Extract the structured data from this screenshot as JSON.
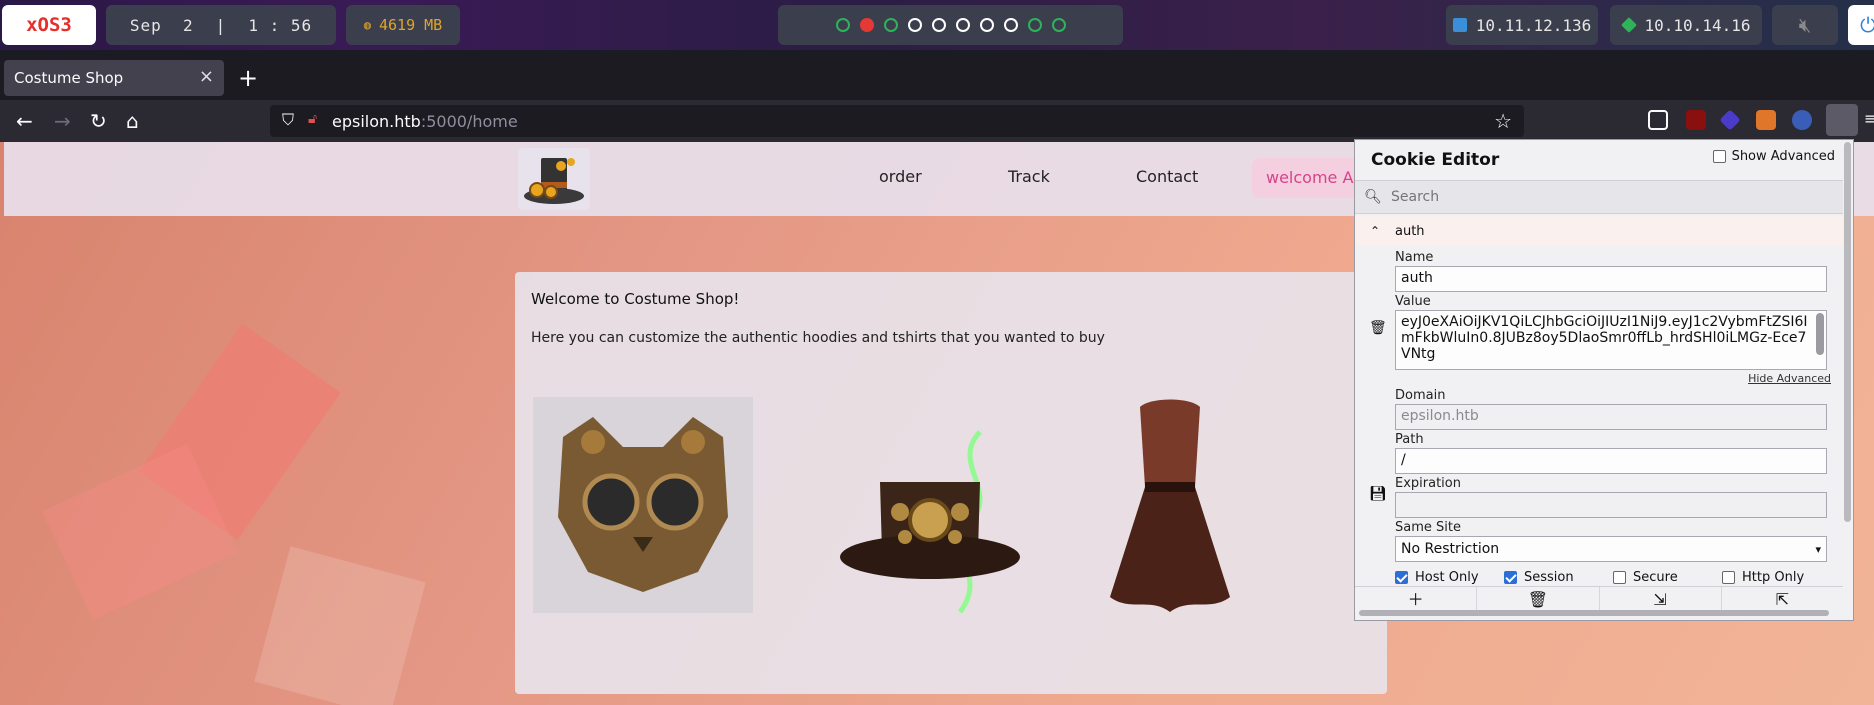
{
  "system_bar": {
    "os_label": "xOS3",
    "date": "Sep  2",
    "time": "1 : 56",
    "memory": "4619 MB",
    "ip_tun": "10.11.12.136",
    "ip_vpn": "10.10.14.16",
    "workspaces": [
      "green",
      "red",
      "green",
      "white",
      "white",
      "white",
      "white",
      "white",
      "green",
      "green"
    ]
  },
  "browser": {
    "tab_title": "Costume Shop",
    "url_host": "epsilon.htb",
    "url_path": ":5000/home"
  },
  "site": {
    "nav": {
      "order": "order",
      "track": "Track",
      "contact": "Contact",
      "welcome": "welcome Admin"
    },
    "welcome_heading": "Welcome to Costume Shop!",
    "welcome_text": "Here you can customize the authentic hoodies and tshirts that you wanted to buy",
    "products": [
      "cat-mask",
      "steampunk-hat",
      "corset-dress"
    ]
  },
  "cookie_editor": {
    "title": "Cookie Editor",
    "show_advanced": "Show Advanced",
    "search_placeholder": "Search",
    "cookie_name": "auth",
    "labels": {
      "name": "Name",
      "value": "Value",
      "domain": "Domain",
      "path": "Path",
      "expiration": "Expiration",
      "same_site": "Same Site"
    },
    "name_value": "auth",
    "value_value": "eyJ0eXAiOiJKV1QiLCJhbGciOiJIUzI1NiJ9.eyJ1c2VybmFtZSI6ImFkbWluIn0.8JUBz8oy5DlaoSmr0ffLb_hrdSHl0iLMGz-Ece7VNtg",
    "hide_advanced": "Hide Advanced",
    "domain_value": "epsilon.htb",
    "path_value": "/",
    "expiration_value": "",
    "same_site_value": "No Restriction",
    "flags": {
      "host_only": "Host Only",
      "session": "Session",
      "secure": "Secure",
      "http_only": "Http Only"
    },
    "flag_states": {
      "host_only": true,
      "session": true,
      "secure": false,
      "http_only": false
    }
  }
}
